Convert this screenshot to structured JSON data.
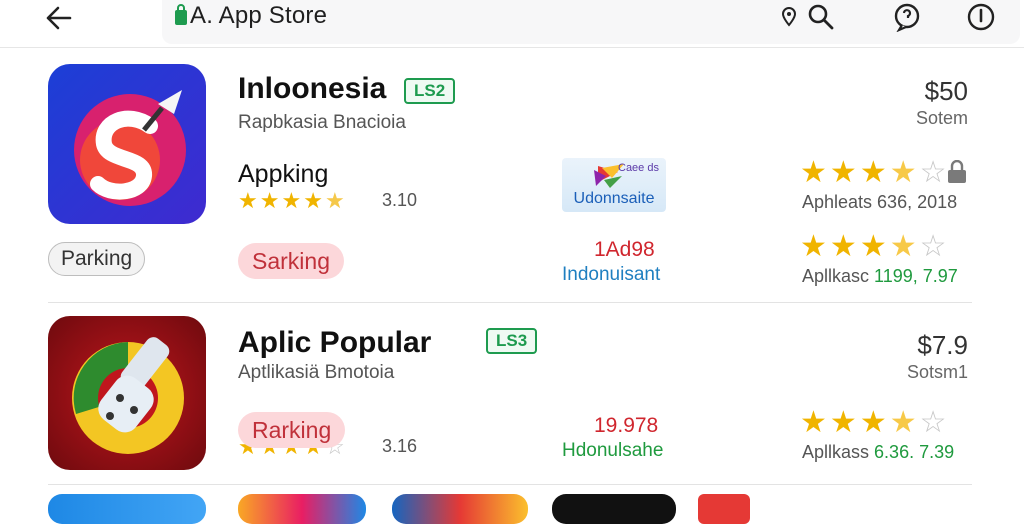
{
  "header": {
    "title": "A. App Store",
    "icons": [
      "back-arrow-icon",
      "store-bag-icon",
      "location-pin-icon",
      "search-icon",
      "chat-icon",
      "info-icon"
    ]
  },
  "app1": {
    "title": "Inloonesia",
    "badge": "LS2",
    "subtitle": "Rapbkasia Bnacioia",
    "price": "$50",
    "price_note": "Sotem",
    "section_label": "Appking",
    "rating_value": "3.10",
    "rating_stars": 4.5,
    "pill_grey": "Parking",
    "pill_red": "Sarking",
    "banner_text": "Udonnsaite",
    "banner_mini": "Caee ds",
    "col2_red": "1Ad98",
    "col2_blue": "Indonuisant",
    "right_stars_1": 3.5,
    "right_meta_1": "Aphleats 636, 2018",
    "right_stars_2": 3.5,
    "right_meta_2_prefix": "Apllkasc",
    "right_meta_2_value": "1199, 7.97"
  },
  "app2": {
    "title": "Aplic Popular",
    "badge": "LS3",
    "subtitle": "Aptlikasiä Bmotoia",
    "price": "$7.9",
    "price_note": "Sotsm1",
    "pill_red": "Rarking",
    "rating_value": "3.16",
    "rating_stars": 4.0,
    "col2_red": "19.978",
    "col2_green": "Hdonulsahe",
    "right_stars": 3.5,
    "right_meta_prefix": "Apllkass",
    "right_meta_value": "6.36. 7.39"
  },
  "colors": {
    "accent_green": "#1e9b4f",
    "star": "#f0b400",
    "pill_red_bg": "#fcd7da",
    "pill_red_text": "#c0313a",
    "price_red": "#d0262e",
    "link_blue": "#1f7fc0"
  }
}
